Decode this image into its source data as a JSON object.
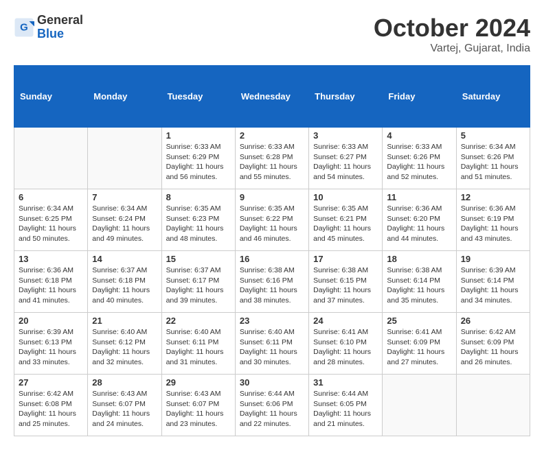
{
  "header": {
    "logo": {
      "general": "General",
      "blue": "Blue"
    },
    "title": "October 2024",
    "location": "Vartej, Gujarat, India"
  },
  "calendar": {
    "days_of_week": [
      "Sunday",
      "Monday",
      "Tuesday",
      "Wednesday",
      "Thursday",
      "Friday",
      "Saturday"
    ],
    "weeks": [
      [
        {
          "day": "",
          "info": ""
        },
        {
          "day": "",
          "info": ""
        },
        {
          "day": "1",
          "info": "Sunrise: 6:33 AM\nSunset: 6:29 PM\nDaylight: 11 hours and 56 minutes."
        },
        {
          "day": "2",
          "info": "Sunrise: 6:33 AM\nSunset: 6:28 PM\nDaylight: 11 hours and 55 minutes."
        },
        {
          "day": "3",
          "info": "Sunrise: 6:33 AM\nSunset: 6:27 PM\nDaylight: 11 hours and 54 minutes."
        },
        {
          "day": "4",
          "info": "Sunrise: 6:33 AM\nSunset: 6:26 PM\nDaylight: 11 hours and 52 minutes."
        },
        {
          "day": "5",
          "info": "Sunrise: 6:34 AM\nSunset: 6:26 PM\nDaylight: 11 hours and 51 minutes."
        }
      ],
      [
        {
          "day": "6",
          "info": "Sunrise: 6:34 AM\nSunset: 6:25 PM\nDaylight: 11 hours and 50 minutes."
        },
        {
          "day": "7",
          "info": "Sunrise: 6:34 AM\nSunset: 6:24 PM\nDaylight: 11 hours and 49 minutes."
        },
        {
          "day": "8",
          "info": "Sunrise: 6:35 AM\nSunset: 6:23 PM\nDaylight: 11 hours and 48 minutes."
        },
        {
          "day": "9",
          "info": "Sunrise: 6:35 AM\nSunset: 6:22 PM\nDaylight: 11 hours and 46 minutes."
        },
        {
          "day": "10",
          "info": "Sunrise: 6:35 AM\nSunset: 6:21 PM\nDaylight: 11 hours and 45 minutes."
        },
        {
          "day": "11",
          "info": "Sunrise: 6:36 AM\nSunset: 6:20 PM\nDaylight: 11 hours and 44 minutes."
        },
        {
          "day": "12",
          "info": "Sunrise: 6:36 AM\nSunset: 6:19 PM\nDaylight: 11 hours and 43 minutes."
        }
      ],
      [
        {
          "day": "13",
          "info": "Sunrise: 6:36 AM\nSunset: 6:18 PM\nDaylight: 11 hours and 41 minutes."
        },
        {
          "day": "14",
          "info": "Sunrise: 6:37 AM\nSunset: 6:18 PM\nDaylight: 11 hours and 40 minutes."
        },
        {
          "day": "15",
          "info": "Sunrise: 6:37 AM\nSunset: 6:17 PM\nDaylight: 11 hours and 39 minutes."
        },
        {
          "day": "16",
          "info": "Sunrise: 6:38 AM\nSunset: 6:16 PM\nDaylight: 11 hours and 38 minutes."
        },
        {
          "day": "17",
          "info": "Sunrise: 6:38 AM\nSunset: 6:15 PM\nDaylight: 11 hours and 37 minutes."
        },
        {
          "day": "18",
          "info": "Sunrise: 6:38 AM\nSunset: 6:14 PM\nDaylight: 11 hours and 35 minutes."
        },
        {
          "day": "19",
          "info": "Sunrise: 6:39 AM\nSunset: 6:14 PM\nDaylight: 11 hours and 34 minutes."
        }
      ],
      [
        {
          "day": "20",
          "info": "Sunrise: 6:39 AM\nSunset: 6:13 PM\nDaylight: 11 hours and 33 minutes."
        },
        {
          "day": "21",
          "info": "Sunrise: 6:40 AM\nSunset: 6:12 PM\nDaylight: 11 hours and 32 minutes."
        },
        {
          "day": "22",
          "info": "Sunrise: 6:40 AM\nSunset: 6:11 PM\nDaylight: 11 hours and 31 minutes."
        },
        {
          "day": "23",
          "info": "Sunrise: 6:40 AM\nSunset: 6:11 PM\nDaylight: 11 hours and 30 minutes."
        },
        {
          "day": "24",
          "info": "Sunrise: 6:41 AM\nSunset: 6:10 PM\nDaylight: 11 hours and 28 minutes."
        },
        {
          "day": "25",
          "info": "Sunrise: 6:41 AM\nSunset: 6:09 PM\nDaylight: 11 hours and 27 minutes."
        },
        {
          "day": "26",
          "info": "Sunrise: 6:42 AM\nSunset: 6:09 PM\nDaylight: 11 hours and 26 minutes."
        }
      ],
      [
        {
          "day": "27",
          "info": "Sunrise: 6:42 AM\nSunset: 6:08 PM\nDaylight: 11 hours and 25 minutes."
        },
        {
          "day": "28",
          "info": "Sunrise: 6:43 AM\nSunset: 6:07 PM\nDaylight: 11 hours and 24 minutes."
        },
        {
          "day": "29",
          "info": "Sunrise: 6:43 AM\nSunset: 6:07 PM\nDaylight: 11 hours and 23 minutes."
        },
        {
          "day": "30",
          "info": "Sunrise: 6:44 AM\nSunset: 6:06 PM\nDaylight: 11 hours and 22 minutes."
        },
        {
          "day": "31",
          "info": "Sunrise: 6:44 AM\nSunset: 6:05 PM\nDaylight: 11 hours and 21 minutes."
        },
        {
          "day": "",
          "info": ""
        },
        {
          "day": "",
          "info": ""
        }
      ]
    ]
  }
}
